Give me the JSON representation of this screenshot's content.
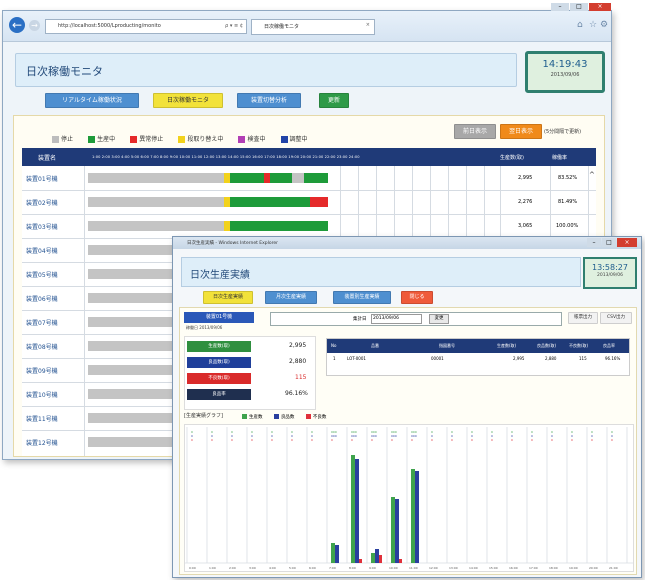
{
  "browser": {
    "address_url": "http://localhost:5000/Lproducting/monito",
    "address_controls": "ρ ▾ ≡ ¢",
    "tab_title": "日次稼働モニタ",
    "icons": [
      "back-icon",
      "forward-icon",
      "home-icon",
      "star-icon",
      "gear-icon"
    ]
  },
  "monitor": {
    "title": "日次稼働モニタ",
    "clock_time": "14:19:43",
    "clock_date": "2013/09/06",
    "nav_buttons": [
      "リアルタイム稼働状況",
      "日次稼働モニタ",
      "装置切替分析",
      "更新"
    ],
    "right_buttons": [
      "前日表示",
      "翌日表示"
    ],
    "auto_refresh_note": "(5分間隔で更新)",
    "legend": [
      {
        "label": "停止",
        "color": "#bdbdbd"
      },
      {
        "label": "生産中",
        "color": "#1e9b3a"
      },
      {
        "label": "異常停止",
        "color": "#e52a2a"
      },
      {
        "label": "段取り替え中",
        "color": "#f2d21b"
      },
      {
        "label": "検査中",
        "color": "#b23fb5"
      },
      {
        "label": "調整中",
        "color": "#2244a8"
      }
    ],
    "header_device": "装置名",
    "header_hours": "1:00 2:00 3:00 4:00 5:00 6:00 7:00 8:00 9:00 10:00 11:00 12:00 13:00 14:00 15:00 16:00 17:00 18:00 19:00 20:00 21:00 22:00 23:00 24:00",
    "header_output": "生産数(取)",
    "header_rate": "稼働率",
    "rows": [
      {
        "name": "装置01号機",
        "output": "2,995",
        "rate": "83.52%"
      },
      {
        "name": "装置02号機",
        "output": "2,276",
        "rate": "81.49%"
      },
      {
        "name": "装置03号機",
        "output": "3,065",
        "rate": "100.00%"
      },
      {
        "name": "装置04号機",
        "output": "",
        "rate": ""
      },
      {
        "name": "装置05号機",
        "output": "",
        "rate": ""
      },
      {
        "name": "装置06号機",
        "output": "",
        "rate": ""
      },
      {
        "name": "装置07号機",
        "output": "",
        "rate": ""
      },
      {
        "name": "装置08号機",
        "output": "",
        "rate": ""
      },
      {
        "name": "装置09号機",
        "output": "",
        "rate": ""
      },
      {
        "name": "装置10号機",
        "output": "",
        "rate": ""
      },
      {
        "name": "装置11号機",
        "output": "",
        "rate": ""
      },
      {
        "name": "装置12号機",
        "output": "",
        "rate": ""
      }
    ]
  },
  "production": {
    "window_title": "日次生産実績 - Windows Internet Explorer",
    "title": "日次生産実績",
    "clock_time": "13:58:27",
    "clock_date": "2013/09/06",
    "nav_buttons": [
      "日次生産実績",
      "月次生産実績",
      "装置別生産実績",
      "閉じる"
    ],
    "machine_tag": "装置01号機",
    "machine_sub": "稼働日 2013/09/06",
    "date_label": "集計日",
    "date_value": "2013/09/06",
    "date_button": "変更",
    "top_right_buttons": [
      "帳票出力",
      "CSV出力"
    ],
    "stats": [
      {
        "label": "生産数(取)",
        "value": "2,995",
        "color": "#2f8f3f"
      },
      {
        "label": "良品数(取)",
        "value": "2,880",
        "color": "#1f3f9a"
      },
      {
        "label": "不良数(取)",
        "value": "115",
        "color": "#d92a2a"
      },
      {
        "label": "良品率",
        "value": "96.16%",
        "color": "#1f2f4f"
      }
    ],
    "table_headers": [
      "No",
      "品番",
      "指図番号",
      "生産数(取)",
      "良品数(取)",
      "不良数(取)",
      "良品率"
    ],
    "table_row": [
      "1",
      "LOT-0001",
      "00001",
      "2,995",
      "2,880",
      "115",
      "96.16%"
    ],
    "graph_title": "[生産実績グラフ]",
    "graph_legend": [
      {
        "label": "生産数",
        "color": "#3fa34d"
      },
      {
        "label": "良品数",
        "color": "#2a3f9f"
      },
      {
        "label": "不良数",
        "color": "#e0303a"
      }
    ]
  }
}
